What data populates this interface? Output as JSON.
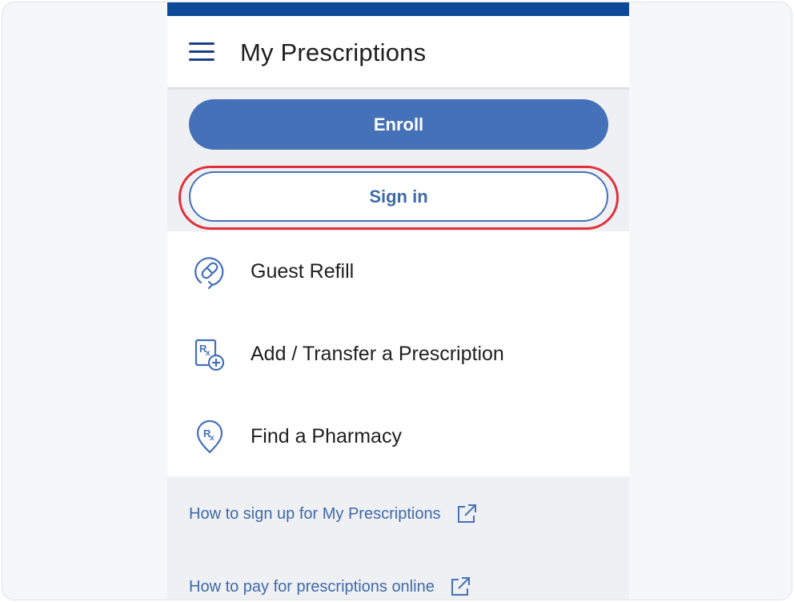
{
  "header": {
    "title": "My Prescriptions"
  },
  "auth": {
    "enroll_label": "Enroll",
    "signin_label": "Sign in"
  },
  "menu": [
    {
      "label": "Guest Refill",
      "icon": "pill-refill-icon"
    },
    {
      "label": "Add / Transfer a Prescription",
      "icon": "rx-add-icon"
    },
    {
      "label": "Find a Pharmacy",
      "icon": "rx-location-icon"
    }
  ],
  "links": [
    {
      "label": "How to sign up for My Prescriptions",
      "icon": "external-link-icon"
    },
    {
      "label": "How to pay for prescriptions online",
      "icon": "external-link-icon"
    }
  ],
  "colors": {
    "brand": "#0e4a99",
    "accent": "#4571b8",
    "highlight": "#e0303c"
  }
}
